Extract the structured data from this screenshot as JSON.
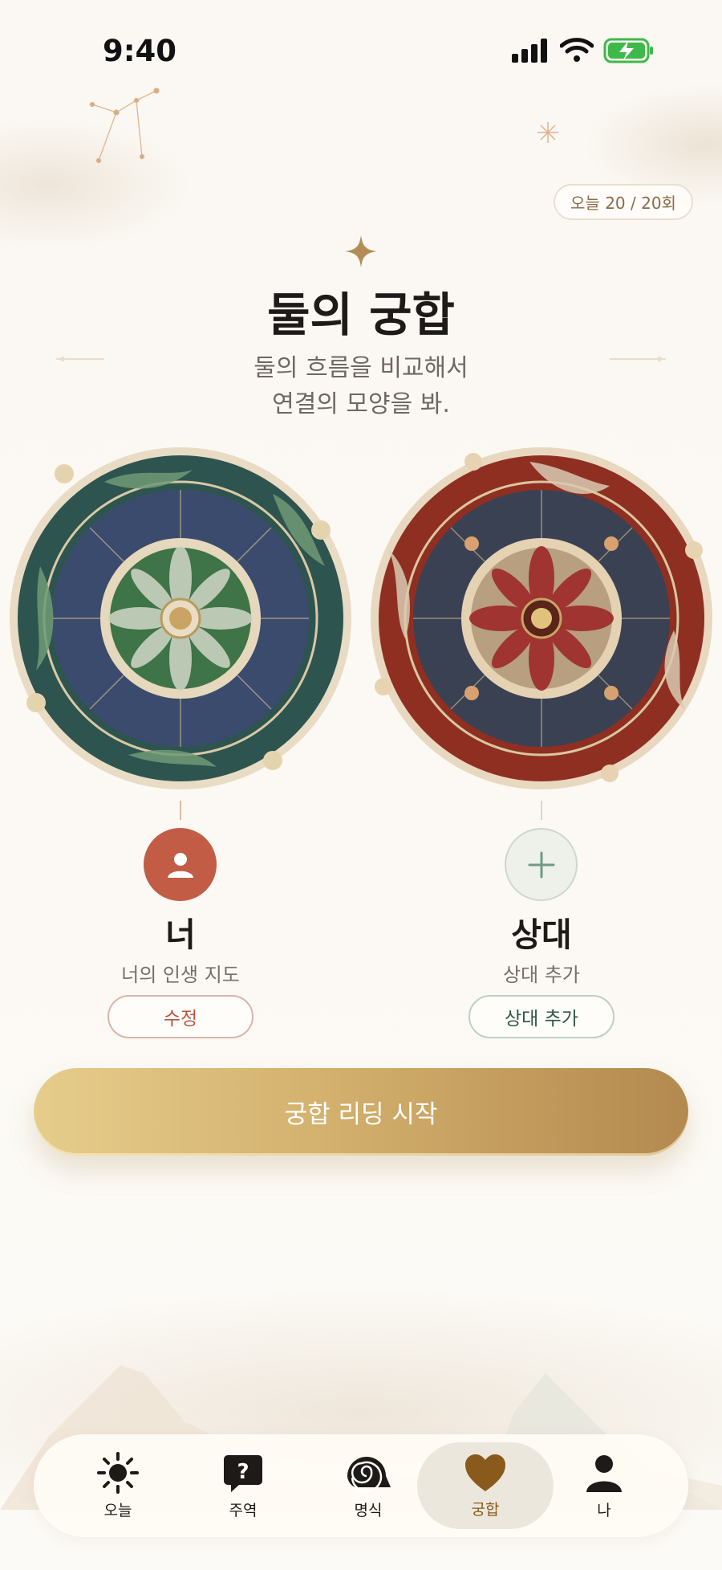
{
  "status_bar": {
    "time": "9:40"
  },
  "header": {
    "counter": "오늘 20 / 20회",
    "title": "둘의 궁합",
    "subtitle_line1": "둘의 흐름을 비교해서",
    "subtitle_line2": "연결의 모양을 봐."
  },
  "profiles": {
    "me": {
      "name": "너",
      "caption": "너의 인생 지도",
      "button": "수정",
      "wheel_theme": "green-mandala"
    },
    "partner": {
      "name": "상대",
      "caption": "상대 추가",
      "button": "상대 추가",
      "wheel_theme": "red-mandala"
    }
  },
  "cta_label": "궁합 리딩 시작",
  "tabs": [
    {
      "label": "오늘",
      "icon": "sun-icon",
      "active": false
    },
    {
      "label": "주역",
      "icon": "question-bubble-icon",
      "active": false
    },
    {
      "label": "명식",
      "icon": "nautilus-shell-icon",
      "active": false
    },
    {
      "label": "궁합",
      "icon": "heart-icon",
      "active": true
    },
    {
      "label": "나",
      "icon": "person-icon",
      "active": false
    }
  ],
  "colors": {
    "accent_gold": "#c9a464",
    "me_red": "#c25c44",
    "partner_green": "#2e5849",
    "active_tab": "#8a5a1c"
  }
}
